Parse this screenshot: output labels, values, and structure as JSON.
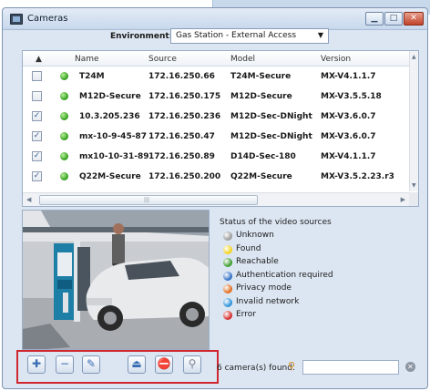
{
  "window": {
    "title": "Cameras"
  },
  "environment": {
    "label": "Environment:",
    "value": "Gas Station - External Access"
  },
  "grid": {
    "columns": [
      "Name",
      "Source",
      "Model",
      "Version"
    ],
    "rows": [
      {
        "checked": false,
        "name": "T24M",
        "source": "172.16.250.66",
        "model": "T24M-Secure",
        "version": "MX-V4.1.1.7"
      },
      {
        "checked": false,
        "name": "M12D-Secure",
        "source": "172.16.250.175",
        "model": "M12D-Secure",
        "version": "MX-V3.5.5.18"
      },
      {
        "checked": true,
        "name": "10.3.205.236",
        "source": "172.16.250.236",
        "model": "M12D-Sec-DNight",
        "version": "MX-V3.6.0.7"
      },
      {
        "checked": true,
        "name": "mx-10-9-45-87",
        "source": "172.16.250.47",
        "model": "M12D-Sec-DNight",
        "version": "MX-V3.6.0.7"
      },
      {
        "checked": true,
        "name": "mx10-10-31-89",
        "source": "172.16.250.89",
        "model": "D14D-Sec-180",
        "version": "MX-V4.1.1.7"
      },
      {
        "checked": true,
        "name": "Q22M-Secure",
        "source": "172.16.250.200",
        "model": "Q22M-Secure",
        "version": "MX-V3.5.2.23.r3"
      }
    ]
  },
  "status": {
    "title": "Status of the video sources",
    "items": [
      {
        "label": "Unknown",
        "color": "#9a9a9a"
      },
      {
        "label": "Found",
        "color": "#f2d21b"
      },
      {
        "label": "Reachable",
        "color": "#3a9c2a"
      },
      {
        "label": "Authentication required",
        "color": "#2f6fc4"
      },
      {
        "label": "Privacy mode",
        "color": "#e06a1a"
      },
      {
        "label": "Invalid network",
        "color": "#2a8fd9"
      },
      {
        "label": "Error",
        "color": "#d42a2a"
      }
    ]
  },
  "toolbar": {
    "buttons": [
      {
        "icon": "add-icon",
        "glyph": "✚"
      },
      {
        "icon": "remove-icon",
        "glyph": "−"
      },
      {
        "icon": "edit-icon",
        "glyph": "✎"
      },
      {
        "icon": "eject-icon",
        "glyph": "⏏"
      },
      {
        "icon": "privacy-icon",
        "glyph": "⛔"
      },
      {
        "icon": "binoculars-icon",
        "glyph": "⚲"
      }
    ]
  },
  "footer": {
    "found_text": "6 camera(s) found.",
    "search_placeholder": ""
  }
}
